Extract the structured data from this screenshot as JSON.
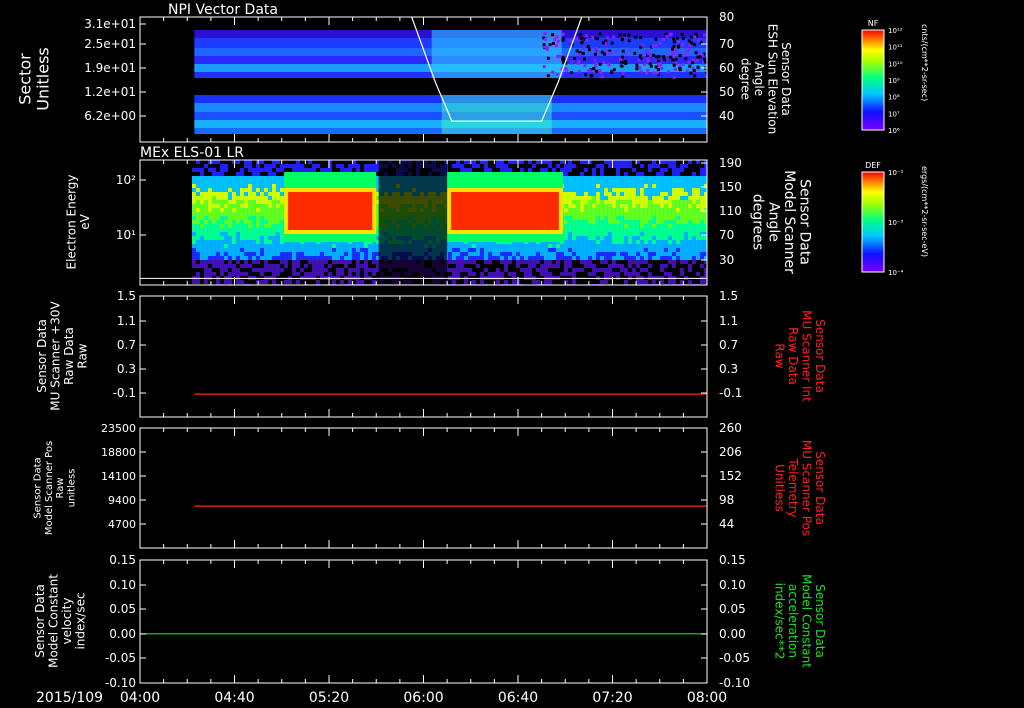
{
  "colors": {
    "background": "#000000",
    "frame": "#ffffff",
    "text": "#ffffff",
    "red": "#ff2020",
    "green": "#20e020"
  },
  "time_axis": {
    "date_label": "2015/109",
    "ticks": [
      "04:00",
      "04:40",
      "05:20",
      "06:00",
      "06:40",
      "07:20",
      "08:00"
    ],
    "start": "04:00",
    "end": "08:00"
  },
  "chart_data": [
    {
      "type": "heatmap",
      "title": "NPI Vector Data",
      "ylabel": "Sector\nUnitless",
      "y_ticks": [
        "3.1e+01",
        "2.5e+01",
        "1.9e+01",
        "1.2e+01",
        "6.2e+00"
      ],
      "right_ylabel": "Sensor Data\nESH Sun Elevation\nAngle\ndegree",
      "right_y_ticks": [
        "80",
        "70",
        "60",
        "50",
        "40"
      ],
      "right_ylim": [
        32,
        80
      ],
      "colorbar": {
        "label": "NF",
        "unit": "cnts/(cm**2-sr-sec)",
        "ticks": [
          "10¹²",
          "10¹¹",
          "10¹⁰",
          "10⁹",
          "10⁸",
          "10⁷",
          "10⁶"
        ]
      },
      "data_start": "04:23",
      "overlay_line": {
        "color": "white",
        "x": [
          "05:55",
          "06:05",
          "06:12",
          "06:50",
          "06:57",
          "07:07"
        ],
        "y": [
          80,
          55,
          40,
          40,
          55,
          80
        ]
      }
    },
    {
      "type": "heatmap",
      "title": "MEx ELS-01 LR",
      "ylabel": "Electron Energy\neV",
      "y_ticks": [
        "10²",
        "10¹"
      ],
      "right_ylabel": "Sensor Data\nModel Scanner\nAngle\ndegrees",
      "right_y_ticks": [
        "190",
        "150",
        "110",
        "70",
        "30"
      ],
      "right_ylim": [
        2,
        190
      ],
      "colorbar": {
        "label": "DEF",
        "unit": "ergs/(cm**2-sr-sec-eV)",
        "ticks": [
          "10⁻²",
          "10⁻³",
          "10⁻⁴"
        ]
      },
      "data_start": "04:22",
      "high_flux_intervals": [
        [
          "05:01",
          "05:40"
        ],
        [
          "06:10",
          "06:59"
        ]
      ],
      "overlay_line": {
        "color": "white",
        "value": 12
      }
    },
    {
      "type": "line",
      "ylabel": "Sensor Data\nMU Scanner +30V\nRaw Data\nRaw",
      "y_ticks": [
        "1.5",
        "1.1",
        "0.7",
        "0.3",
        "-0.1"
      ],
      "ylim": [
        -0.35,
        1.5
      ],
      "right_ylabel": "Sensor Data\nMU Scanner Int\nRaw Data\nRaw",
      "right_y_ticks": [
        "1.5",
        "1.1",
        "0.7",
        "0.3",
        "-0.1"
      ],
      "series": [
        {
          "color": "red",
          "x": [
            "04:23",
            "08:00"
          ],
          "y": [
            0.0,
            0.0
          ]
        }
      ]
    },
    {
      "type": "line",
      "ylabel": "Sensor Data\nModel Scanner Pos\nRaw\nunitless",
      "y_ticks": [
        "23500",
        "18800",
        "14100",
        "9400",
        "4700"
      ],
      "ylim": [
        0,
        23500
      ],
      "right_ylabel": "Sensor Data\nMU Scanner Pos\nTelemetry\nUnitless",
      "right_y_ticks": [
        "260",
        "206",
        "152",
        "98",
        "44"
      ],
      "series": [
        {
          "color": "red",
          "x": [
            "04:23",
            "08:00"
          ],
          "y": [
            8200,
            8200
          ]
        }
      ]
    },
    {
      "type": "line",
      "ylabel": "Sensor Data\nModel Constant\nvelocity\nindex/sec",
      "y_ticks": [
        "0.15",
        "0.10",
        "0.05",
        "0.00",
        "-0.05",
        "-0.10"
      ],
      "ylim": [
        -0.1,
        0.15
      ],
      "right_ylabel": "Sensor Data\nModel Constant\nacceleration\nindex/sec**2",
      "right_y_ticks": [
        "0.15",
        "0.10",
        "0.05",
        "0.00",
        "-0.05",
        "-0.10"
      ],
      "series": [
        {
          "color": "green",
          "x": [
            "04:00",
            "08:00"
          ],
          "y": [
            0.0,
            0.0
          ]
        }
      ]
    }
  ]
}
